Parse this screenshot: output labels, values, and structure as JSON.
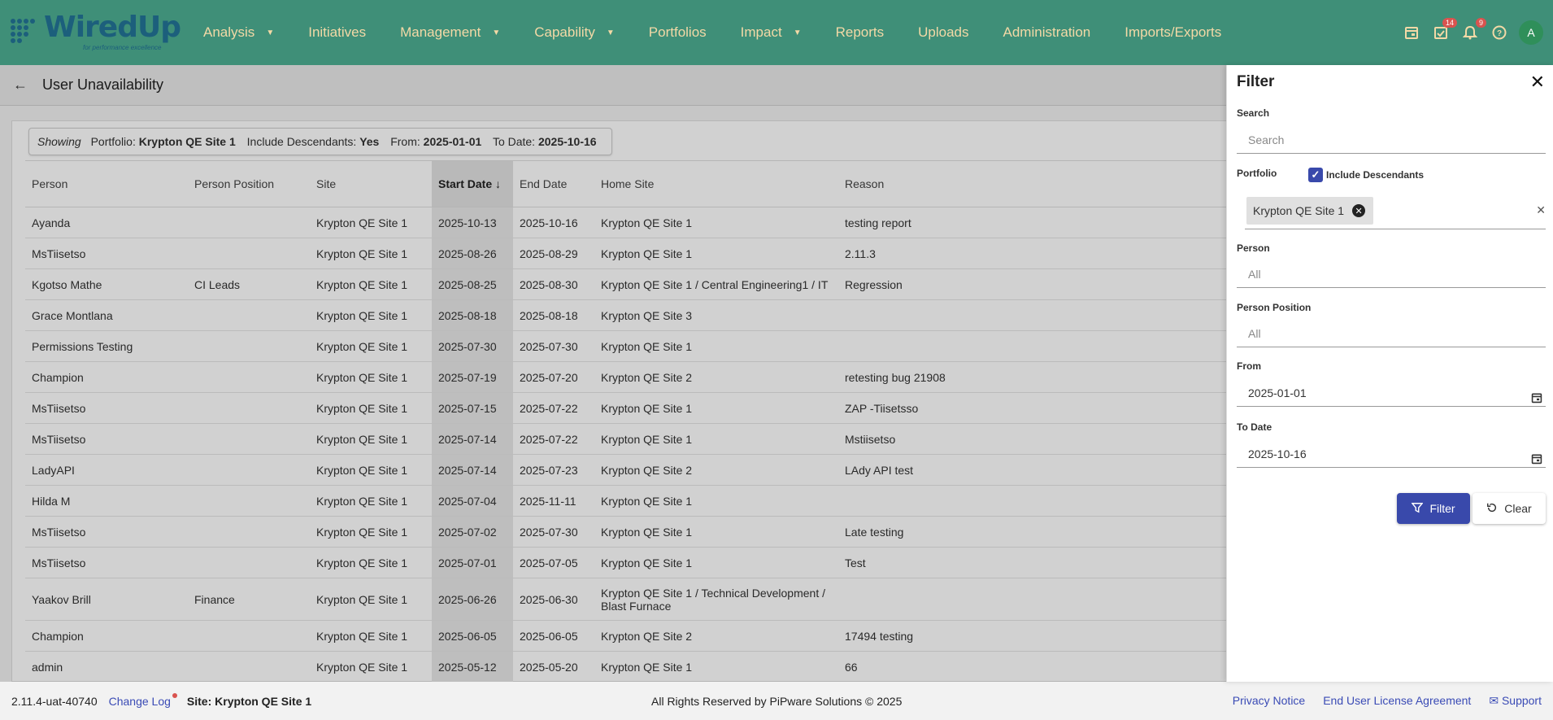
{
  "logo": {
    "text": "WiredUp",
    "tagline": "for performance excellence"
  },
  "nav": {
    "items": [
      {
        "label": "Analysis",
        "dropdown": true
      },
      {
        "label": "Initiatives",
        "dropdown": false
      },
      {
        "label": "Management",
        "dropdown": true
      },
      {
        "label": "Capability",
        "dropdown": true
      },
      {
        "label": "Portfolios",
        "dropdown": false
      },
      {
        "label": "Impact",
        "dropdown": true
      },
      {
        "label": "Reports",
        "dropdown": false
      },
      {
        "label": "Uploads",
        "dropdown": false
      },
      {
        "label": "Administration",
        "dropdown": false
      },
      {
        "label": "Imports/Exports",
        "dropdown": false
      }
    ],
    "tasks_badge": "14",
    "notifications_badge": "9",
    "avatar_initial": "A"
  },
  "header": {
    "title": "User Unavailability"
  },
  "showing": {
    "prefix": "Showing",
    "portfolio_label": "Portfolio:",
    "portfolio_value": "Krypton QE Site 1",
    "descendants_label": "Include Descendants:",
    "descendants_value": "Yes",
    "from_label": "From:",
    "from_value": "2025-01-01",
    "to_label": "To Date:",
    "to_value": "2025-10-16"
  },
  "table": {
    "columns": [
      "Person",
      "Person Position",
      "Site",
      "Start Date",
      "End Date",
      "Home Site",
      "Reason"
    ],
    "sort_indicator": "↓",
    "rows": [
      [
        "Ayanda",
        "",
        "Krypton QE Site 1",
        "2025-10-13",
        "2025-10-16",
        "Krypton QE Site 1",
        "testing report"
      ],
      [
        "MsTiisetso",
        "",
        "Krypton QE Site 1",
        "2025-08-26",
        "2025-08-29",
        "Krypton QE Site 1",
        "2.11.3"
      ],
      [
        "Kgotso Mathe",
        "CI Leads",
        "Krypton QE Site 1",
        "2025-08-25",
        "2025-08-30",
        "Krypton QE Site 1 / Central Engineering1 / IT",
        "Regression"
      ],
      [
        "Grace Montlana",
        "",
        "Krypton QE Site 1",
        "2025-08-18",
        "2025-08-18",
        "Krypton QE Site 3",
        ""
      ],
      [
        "Permissions Testing",
        "",
        "Krypton QE Site 1",
        "2025-07-30",
        "2025-07-30",
        "Krypton QE Site 1",
        ""
      ],
      [
        "Champion",
        "",
        "Krypton QE Site 1",
        "2025-07-19",
        "2025-07-20",
        "Krypton QE Site 2",
        "retesting bug 21908"
      ],
      [
        "MsTiisetso",
        "",
        "Krypton QE Site 1",
        "2025-07-15",
        "2025-07-22",
        "Krypton QE Site 1",
        "ZAP -Tiisetsso"
      ],
      [
        "MsTiisetso",
        "",
        "Krypton QE Site 1",
        "2025-07-14",
        "2025-07-22",
        "Krypton QE Site 1",
        "Mstiisetso"
      ],
      [
        "LadyAPI",
        "",
        "Krypton QE Site 1",
        "2025-07-14",
        "2025-07-23",
        "Krypton QE Site 2",
        "LAdy API test"
      ],
      [
        "Hilda M",
        "",
        "Krypton QE Site 1",
        "2025-07-04",
        "2025-11-11",
        "Krypton QE Site 1",
        ""
      ],
      [
        "MsTiisetso",
        "",
        "Krypton QE Site 1",
        "2025-07-02",
        "2025-07-30",
        "Krypton QE Site 1",
        "Late testing"
      ],
      [
        "MsTiisetso",
        "",
        "Krypton QE Site 1",
        "2025-07-01",
        "2025-07-05",
        "Krypton QE Site 1",
        "Test"
      ],
      [
        "Yaakov Brill",
        "Finance",
        "Krypton QE Site 1",
        "2025-06-26",
        "2025-06-30",
        "Krypton QE Site 1 / Technical Development / Blast Furnace",
        ""
      ],
      [
        "Champion",
        "",
        "Krypton QE Site 1",
        "2025-06-05",
        "2025-06-05",
        "Krypton QE Site 2",
        "17494 testing"
      ],
      [
        "admin",
        "",
        "Krypton QE Site 1",
        "2025-05-12",
        "2025-05-20",
        "Krypton QE Site 1",
        "66"
      ]
    ]
  },
  "filter": {
    "title": "Filter",
    "search_label": "Search",
    "search_placeholder": "Search",
    "portfolio_label": "Portfolio",
    "include_descendants_label": "Include Descendants",
    "portfolio_chip": "Krypton QE Site 1",
    "person_label": "Person",
    "person_placeholder": "All",
    "position_label": "Person Position",
    "position_placeholder": "All",
    "from_label": "From",
    "from_value": "2025-01-01",
    "to_label": "To Date",
    "to_value": "2025-10-16",
    "filter_button": "Filter",
    "clear_button": "Clear"
  },
  "footer": {
    "version": "2.11.4-uat-40740",
    "changelog": "Change Log",
    "site": "Site: Krypton QE Site 1",
    "rights": "All Rights Reserved by PiPware Solutions © 2025",
    "privacy": "Privacy Notice",
    "eula": "End User License Agreement",
    "support": "Support"
  },
  "colors": {
    "header_bg": "#3f8f78",
    "nav_text": "#f3d9a6",
    "primary": "#3949ab",
    "link": "#3a4bb5"
  }
}
